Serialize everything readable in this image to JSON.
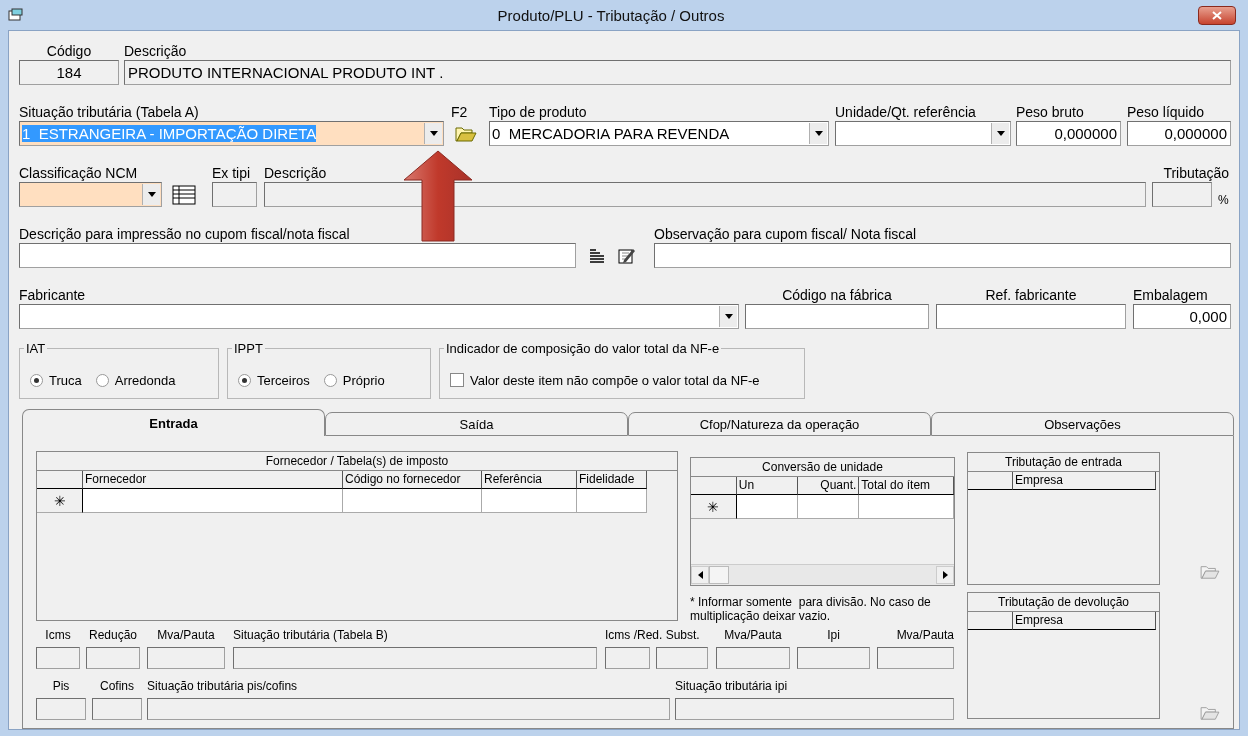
{
  "window": {
    "title": "Produto/PLU - Tributação / Outros"
  },
  "form_rows": [
    [
      {
        "kind": "text",
        "label": "Código",
        "value": "184",
        "disabled": true
      },
      {
        "kind": "text",
        "label": "Descrição",
        "value": "PRODUTO INTERNACIONAL PRODUTO INT .",
        "disabled": true
      }
    ],
    [
      {
        "kind": "combo",
        "label": "Situação tributária (Tabela A)",
        "value": "1  ESTRANGEIRA - IMPORTAÇÃO DIRETA",
        "required": true,
        "text_selected": true
      },
      {
        "kind": "button",
        "label": "F2"
      },
      {
        "kind": "combo",
        "label": "Tipo de produto",
        "value": "0  MERCADORIA PARA REVENDA",
        "required": false,
        "text_selected": false
      },
      {
        "kind": "combo",
        "label": "Unidade/Qt. referência",
        "required": false
      },
      {
        "kind": "text",
        "label": "Peso bruto",
        "value": "0,000000",
        "disabled": false
      },
      {
        "kind": "text",
        "label": "Peso líquido",
        "value": "0,000000",
        "disabled": false
      }
    ],
    [
      {
        "kind": "combo",
        "label": "Classificação NCM",
        "required": true
      },
      {
        "kind": "button"
      },
      {
        "kind": "text",
        "label": "Ex tipi",
        "disabled": true
      },
      {
        "kind": "text",
        "label": "Descrição",
        "disabled": true
      },
      {
        "kind": "text",
        "label": "Tributação",
        "unit": "%",
        "disabled": true
      }
    ],
    [
      {
        "kind": "text",
        "label": "Descrição para impressão no cupom fiscal/nota fiscal",
        "disabled": false
      },
      {
        "kind": "button"
      },
      {
        "kind": "button"
      },
      {
        "kind": "text",
        "label": "Observação para cupom fiscal/ Nota fiscal",
        "disabled": false
      }
    ],
    [
      {
        "kind": "combo",
        "label": "Fabricante",
        "required": false
      },
      {
        "kind": "text",
        "label": "Código na fábrica",
        "disabled": false
      },
      {
        "kind": "text",
        "label": "Ref. fabricante",
        "disabled": false
      },
      {
        "kind": "text",
        "label": "Embalagem",
        "value": "0,000",
        "disabled": false
      }
    ]
  ],
  "option_groups": [
    {
      "title": "IAT",
      "options": [
        {
          "label": "Truca",
          "selected": true
        },
        {
          "label": "Arredonda",
          "selected": false
        }
      ]
    },
    {
      "title": "IPPT",
      "options": [
        {
          "label": "Terceiros",
          "selected": true
        },
        {
          "label": "Próprio",
          "selected": false
        }
      ]
    }
  ],
  "nfe_indicator": {
    "title": "Indicador de composição do valor total da NF-e",
    "checkbox": {
      "label": "Valor deste item não compõe o valor total da NF-e",
      "checked": false
    }
  },
  "tabs": [
    {
      "label": "Entrada",
      "selected": true
    },
    {
      "label": "Saída",
      "selected": false
    },
    {
      "label": "Cfop/Natureza da operação",
      "selected": false
    },
    {
      "label": "Observações",
      "selected": false
    }
  ],
  "fornecedor_grid": {
    "title": "Fornecedor / Tabela(s) de imposto",
    "columns": [
      "Fornecedor",
      "Código no fornecedor",
      "Referência",
      "Fidelidade"
    ],
    "new_row_marker": "✳"
  },
  "conversao_grid": {
    "title": "Conversão de unidade",
    "columns": [
      "Un",
      "Quant.",
      "Total do ítem"
    ],
    "new_row_marker": "✳",
    "note": "* Informar somente  para divisão. No caso de multiplicação deixar vazio."
  },
  "tributacao_entrada": {
    "title": "Tributação de entrada",
    "columns": [
      "Empresa"
    ]
  },
  "tributacao_devolucao": {
    "title": "Tributação de devolução",
    "columns": [
      "Empresa"
    ]
  },
  "tax_rows": [
    [
      {
        "kind": "single",
        "label": "Icms"
      },
      {
        "kind": "single",
        "label": "Redução"
      },
      {
        "kind": "single",
        "label": "Mva/Pauta"
      },
      {
        "kind": "single",
        "label": "Situação tributária (Tabela B)"
      },
      {
        "kind": "pair",
        "label": "Icms /Red. Subst."
      },
      {
        "kind": "single",
        "label": "Mva/Pauta"
      },
      {
        "kind": "single",
        "label": "Ipi"
      },
      {
        "kind": "single",
        "label": "Mva/Pauta"
      }
    ],
    [
      {
        "kind": "single",
        "label": "Pis"
      },
      {
        "kind": "single",
        "label": "Cofins"
      },
      {
        "kind": "single",
        "label": "Situação tributária pis/cofins"
      },
      {
        "kind": "single",
        "label": "Situação tributária ipi"
      }
    ]
  ]
}
